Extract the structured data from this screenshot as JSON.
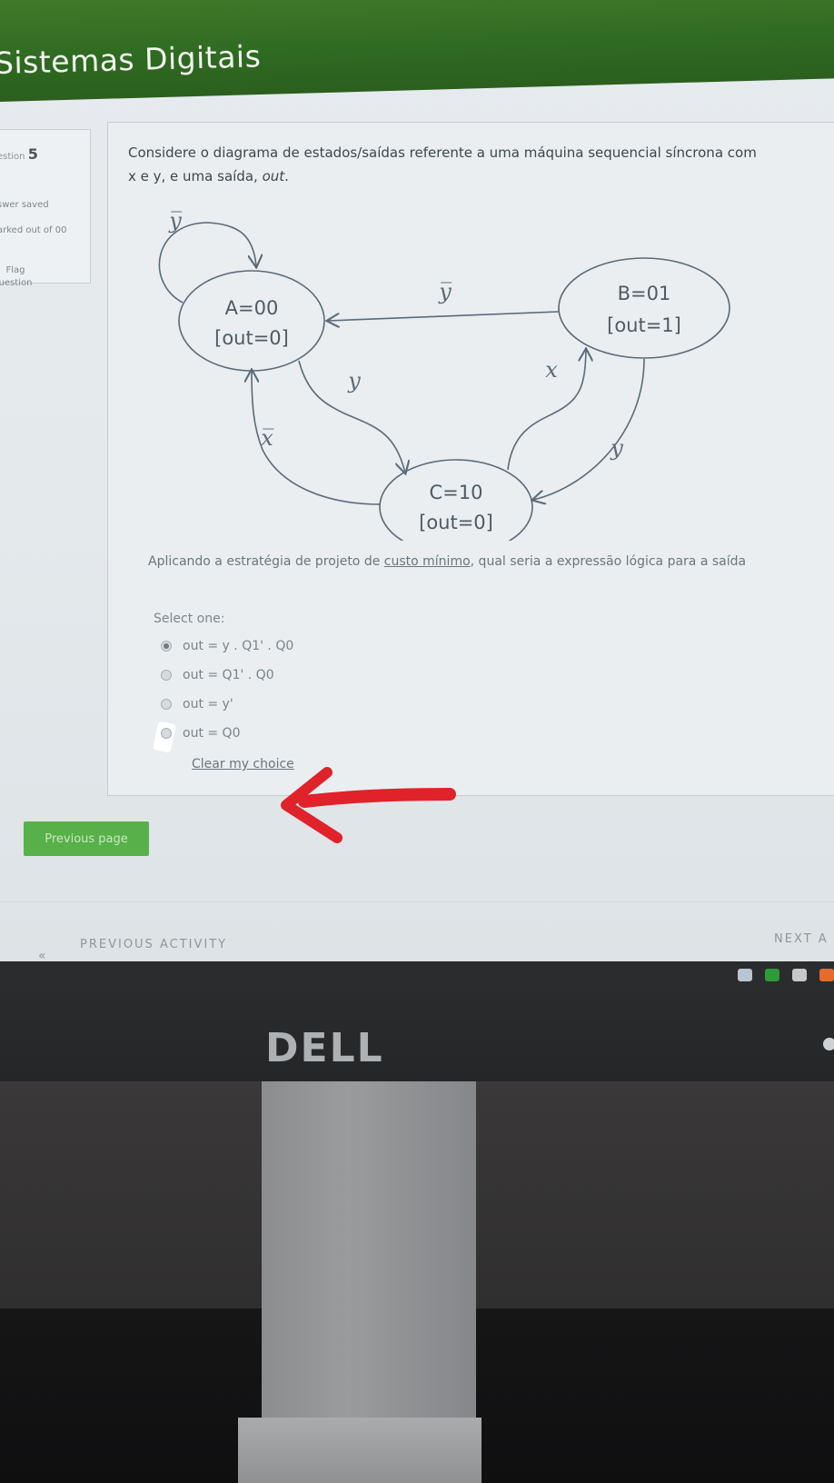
{
  "header": {
    "course_title": "Sistemas Digitais"
  },
  "info": {
    "question_label": "estion",
    "question_number": "5",
    "status": "swer saved",
    "marked": "arked out of 00",
    "flag": "Flag uestion"
  },
  "question": {
    "text_line1": "Considere o diagrama de estados/saídas referente a uma máquina sequencial síncrona com",
    "text_line2_prefix": "x e y, e uma saída, ",
    "text_line2_out": "out",
    "text_line2_suffix": "."
  },
  "diagram": {
    "states": [
      {
        "name": "A=00",
        "output": "[out=0]"
      },
      {
        "name": "B=01",
        "output": "[out=1]"
      },
      {
        "name": "C=10",
        "output": "[out=0]"
      }
    ],
    "transition_labels": {
      "A_self": "y̅",
      "B_to_A": "y̅",
      "A_to_C": "y",
      "C_to_A": "x̅",
      "C_to_B": "x",
      "B_to_C": "y"
    }
  },
  "prompt": {
    "before": "Aplicando a estratégia de projeto de ",
    "underlined": "custo mínimo",
    "after": ", qual seria a expressão lógica para a saída"
  },
  "select_one": "Select one:",
  "options": [
    {
      "label": "out = y . Q1' . Q0",
      "selected": true
    },
    {
      "label": "out = Q1' . Q0",
      "selected": false
    },
    {
      "label": "out = y'",
      "selected": false
    },
    {
      "label": "out = Q0",
      "selected": false
    }
  ],
  "clear_choice": "Clear my choice",
  "buttons": {
    "previous_page": "Previous page"
  },
  "navigation": {
    "previous_activity": "PREVIOUS ACTIVITY",
    "next_activity": "NEXT A"
  },
  "monitor_brand": "DELL",
  "colors": {
    "header_green": "#3f7a2a",
    "button_green": "#58b04a",
    "annotation_red": "#e0222a"
  }
}
